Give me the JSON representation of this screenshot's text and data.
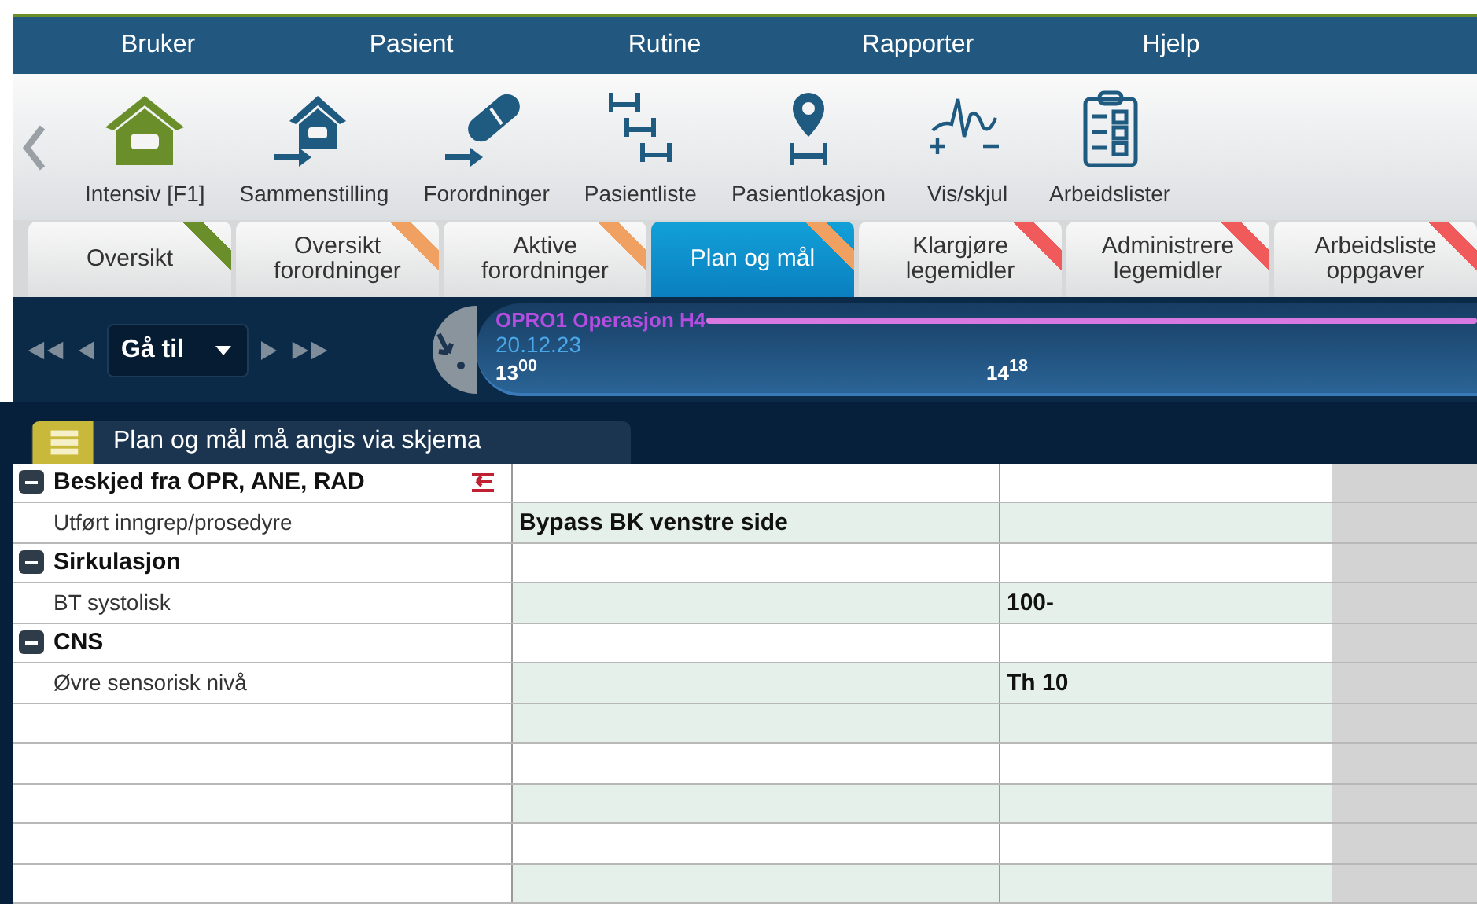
{
  "menu": [
    "Bruker",
    "Pasient",
    "Rutine",
    "Rapporter",
    "Hjelp"
  ],
  "toolbar": [
    {
      "label": "Intensiv [F1]",
      "selected": true
    },
    {
      "label": "Sammenstilling",
      "selected": false
    },
    {
      "label": "Forordninger",
      "selected": false
    },
    {
      "label": "Pasientliste",
      "selected": false
    },
    {
      "label": "Pasientlokasjon",
      "selected": false
    },
    {
      "label": "Vis/skjul",
      "selected": false
    },
    {
      "label": "Arbeidslister",
      "selected": false
    }
  ],
  "tabs": [
    {
      "label": "Oversikt",
      "selected": false,
      "color": "#6a8f2a"
    },
    {
      "label": "Oversikt forordninger",
      "selected": false,
      "color": "#f0a060"
    },
    {
      "label": "Aktive forordninger",
      "selected": false,
      "color": "#f0a060"
    },
    {
      "label": "Plan og mål",
      "selected": true,
      "color": "#f0a060"
    },
    {
      "label": "Klargjøre legemidler",
      "selected": false,
      "color": "#f05a5a"
    },
    {
      "label": "Administrere legemidler",
      "selected": false,
      "color": "#f05a5a"
    },
    {
      "label": "Arbeidsliste oppgaver",
      "selected": false,
      "color": "#f05a5a"
    }
  ],
  "navigator": {
    "goto": "Gå til"
  },
  "timeline": {
    "event": "OPRO1 Operasjon H4",
    "date": "20.12.23",
    "times": [
      "13$^{00}$",
      "14$^{18}$"
    ]
  },
  "notice": "Plan og mål må angis via skjema",
  "grid_rows": [
    {
      "kind": "group",
      "label": "Beskjed fra OPR, ANE, RAD",
      "expanded": true,
      "flagged": true
    },
    {
      "kind": "item",
      "label": "Utført inngrep/prosedyre",
      "column_2": "Bypass BK venstre side"
    },
    {
      "kind": "group",
      "label": "Sirkulasjon",
      "expanded": true,
      "flagged": false
    },
    {
      "kind": "item",
      "label": "BT systolisk",
      "column_3": "100-"
    },
    {
      "kind": "group",
      "label": "CNS",
      "expanded": true,
      "flagged": false
    },
    {
      "kind": "item",
      "label": "Øvre sensorisk nivå",
      "column_3": "Th 10"
    }
  ]
}
